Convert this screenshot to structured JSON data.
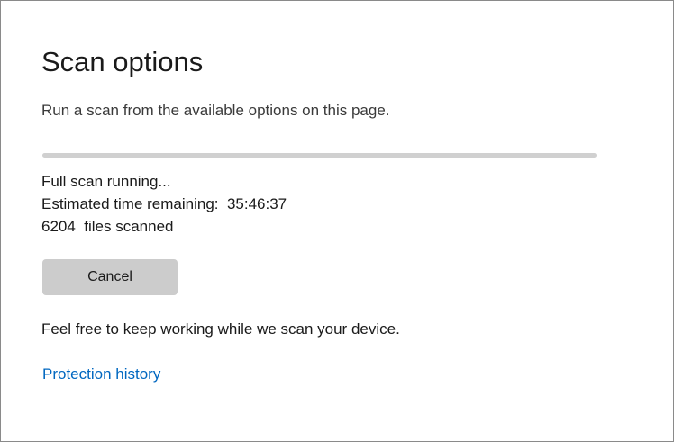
{
  "page": {
    "title": "Scan options",
    "subtitle": "Run a scan from the available options on this page.",
    "progress_percent": 0,
    "status_line": "Full scan running...",
    "time_remaining": "Estimated time remaining:  35:46:37",
    "files_scanned": "6204  files scanned",
    "cancel_label": "Cancel",
    "info_text": "Feel free to keep working while we scan your device.",
    "history_link": "Protection history"
  },
  "colors": {
    "accent": "#0067c0",
    "track": "#d0d0d0",
    "button": "#cccccc"
  }
}
